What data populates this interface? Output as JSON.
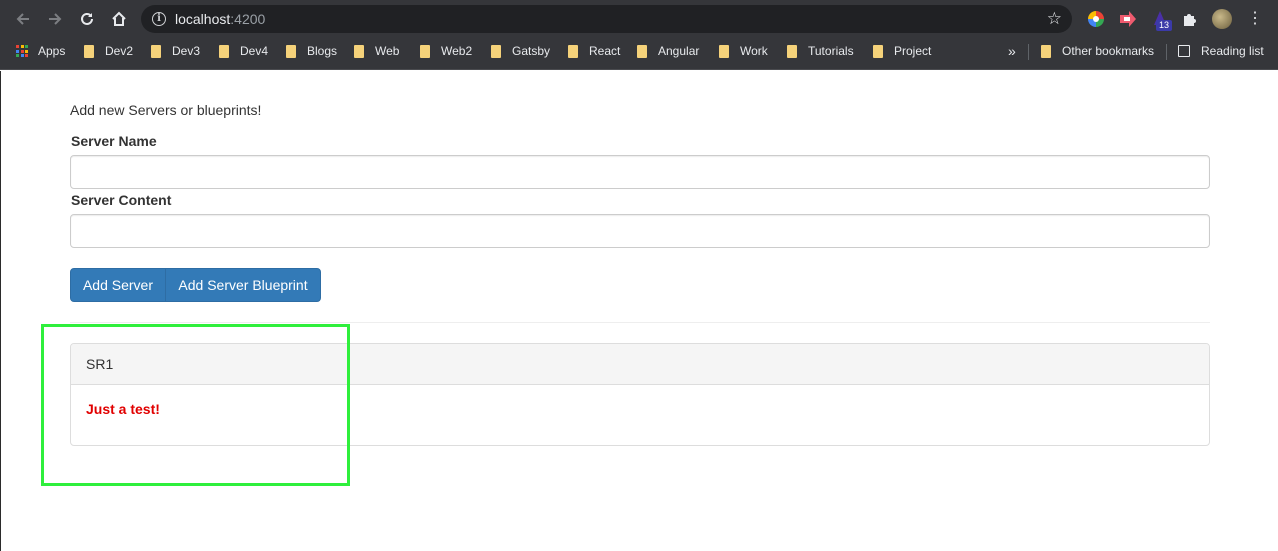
{
  "browser": {
    "url_host": "localhost",
    "url_port": ":4200",
    "extension_badge": "13"
  },
  "bookmarks": {
    "apps_label": "Apps",
    "items": [
      "Dev2",
      "Dev3",
      "Dev4",
      "Blogs",
      "Web",
      "Web2",
      "Gatsby",
      "React",
      "Angular",
      "Work",
      "Tutorials",
      "Project"
    ],
    "overflow_label": "»",
    "other_label": "Other bookmarks",
    "reading_list_label": "Reading list"
  },
  "page": {
    "intro": "Add new Servers or blueprints!",
    "server_name_label": "Server Name",
    "server_name_value": "",
    "server_content_label": "Server Content",
    "server_content_value": "",
    "add_server_label": "Add Server",
    "add_blueprint_label": "Add Server Blueprint",
    "server": {
      "name": "SR1",
      "content": "Just a test!"
    }
  },
  "colors": {
    "primary": "#337ab7",
    "content_text": "#e10000",
    "highlight": "#2fef3c"
  }
}
